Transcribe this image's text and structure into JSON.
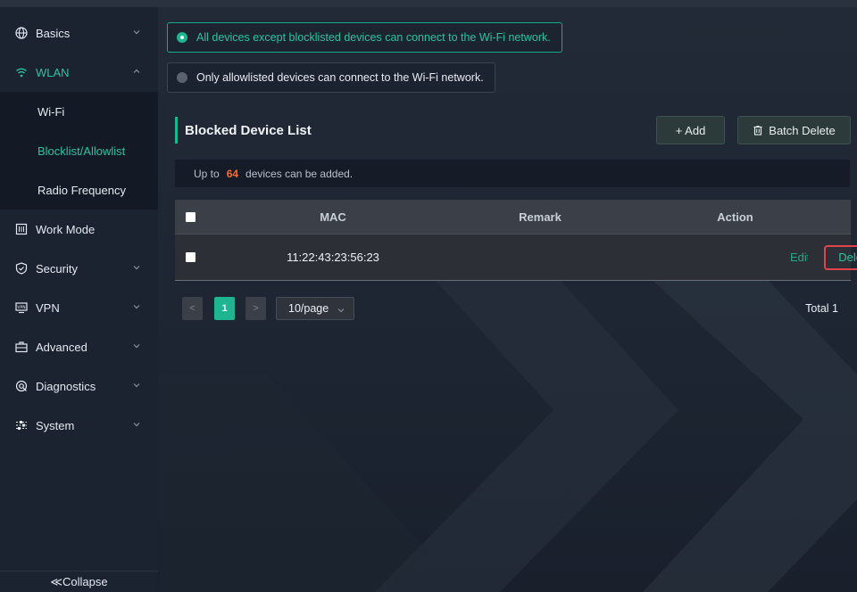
{
  "sidebar": {
    "items": [
      {
        "label": "Basics",
        "icon": "globe-icon"
      },
      {
        "label": "WLAN",
        "icon": "wifi-icon"
      },
      {
        "label": "Work Mode",
        "icon": "work-mode-icon"
      },
      {
        "label": "Security",
        "icon": "shield-icon"
      },
      {
        "label": "VPN",
        "icon": "vpn-icon"
      },
      {
        "label": "Advanced",
        "icon": "toolbox-icon"
      },
      {
        "label": "Diagnostics",
        "icon": "diagnostics-icon"
      },
      {
        "label": "System",
        "icon": "settings-sliders-icon"
      }
    ],
    "wlan_subitems": [
      "Wi-Fi",
      "Blocklist/Allowlist",
      "Radio Frequency"
    ],
    "collapse_label": "≪Collapse"
  },
  "mode": {
    "options": [
      "All devices except blocklisted devices can connect to the Wi-Fi network.",
      "Only allowlisted devices can connect to the Wi-Fi network."
    ],
    "selected": 0
  },
  "section": {
    "title": "Blocked Device List",
    "add_label": "+ Add",
    "batch_delete_label": "Batch Delete"
  },
  "info": {
    "prefix": "Up to",
    "count": "64",
    "suffix": "devices can be added."
  },
  "table": {
    "headers": {
      "mac": "MAC",
      "remark": "Remark",
      "action": "Action"
    },
    "rows": [
      {
        "mac": "11:22:43:23:56:23",
        "remark": "",
        "edit": "Edit",
        "delete": "Delete"
      }
    ]
  },
  "pagination": {
    "current_page": "1",
    "prev_glyph": "<",
    "next_glyph": ">",
    "page_size": "10/page",
    "total": "Total 1"
  },
  "colors": {
    "accent": "#1fb590",
    "highlight_box": "#e2434b",
    "count_highlight": "#ff6a2a"
  }
}
